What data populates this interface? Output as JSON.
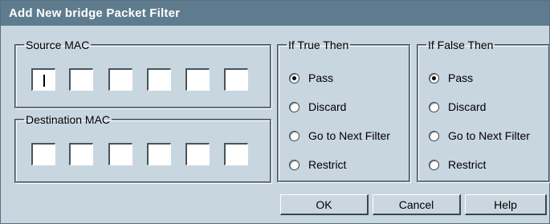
{
  "dialog": {
    "title": "Add New bridge Packet Filter"
  },
  "source_mac": {
    "legend": "Source MAC",
    "octets": [
      "",
      "",
      "",
      "",
      "",
      ""
    ]
  },
  "destination_mac": {
    "legend": "Destination MAC",
    "octets": [
      "",
      "",
      "",
      "",
      "",
      ""
    ]
  },
  "if_true": {
    "legend": "If True Then",
    "options": [
      "Pass",
      "Discard",
      "Go to Next Filter",
      "Restrict"
    ],
    "selected": "Pass"
  },
  "if_false": {
    "legend": "If False Then",
    "options": [
      "Pass",
      "Discard",
      "Go to Next Filter",
      "Restrict"
    ],
    "selected": "Pass"
  },
  "buttons": {
    "ok": "OK",
    "cancel": "Cancel",
    "help": "Help"
  },
  "colors": {
    "titlebar": "#5f7c8e",
    "background": "#c8d6e0"
  }
}
